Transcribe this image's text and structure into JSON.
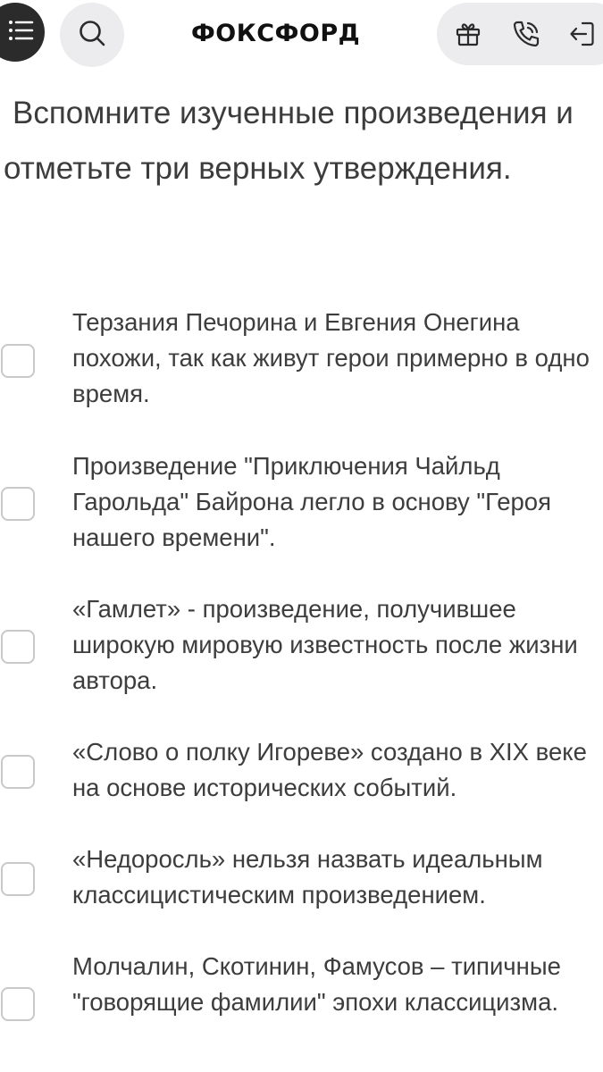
{
  "header": {
    "logo": "ФОКСФОРД",
    "icons": {
      "menu": "list-menu-icon",
      "search": "search-icon",
      "gift": "gift-icon",
      "phone": "phone-icon",
      "logout": "logout-icon"
    }
  },
  "question": {
    "text": "Вспомните изученные произведения и отметьте три верных утверждения."
  },
  "options": [
    {
      "label": "Терзания Печорина и Евгения Онегина похожи, так как живут герои примерно в одно время.",
      "checked": false
    },
    {
      "label": "Произведение \"Приключения Чайльд Гарольда\" Байрона легло в основу \"Героя нашего времени\".",
      "checked": false
    },
    {
      "label": "«Гамлет» - произведение, получившее широкую мировую известность после жизни автора.",
      "checked": false
    },
    {
      "label": "«Слово о полку Игореве» создано в XIX веке на основе исторических событий.",
      "checked": false
    },
    {
      "label": "«Недоросль» нельзя назвать идеальным классицистическим произведением.",
      "checked": false
    },
    {
      "label": "Молчалин, Скотинин, Фамусов – типичные \"говорящие фамилии\" эпохи классицизма.",
      "checked": false
    }
  ],
  "colors": {
    "menu_button_bg": "#2b2b2b",
    "pill_bg": "#ececee",
    "text": "#3d3d3d",
    "checkbox_border": "#c9c9cc"
  }
}
